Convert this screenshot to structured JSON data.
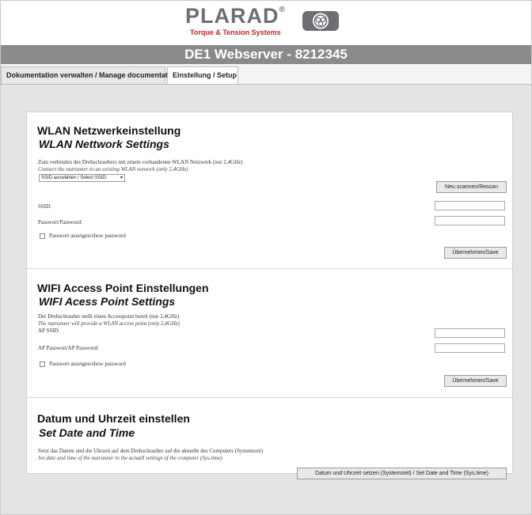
{
  "brand": {
    "name": "PLARAD",
    "reg": "®",
    "tagline": "Torque & Tension Systems",
    "color_red": "#c1272d",
    "color_gray": "#6d6f72"
  },
  "title": "DE1 Webserver - 8212345",
  "tabs": [
    {
      "label": "Dokumentation verwalten / Manage documentation",
      "active": false
    },
    {
      "label": "Einstellung / Setup",
      "active": true
    }
  ],
  "wlan": {
    "title_de": "WLAN Netzwerkeinstellung",
    "title_en": "WLAN Nettwork Settings",
    "desc_de": "Zum verbinden des Drehschraubers mit einem vorhandenen WLAN Netzwerk (nur 2,4GHz)",
    "desc_en": "Connect the nutrunner to an existing WLAN network (only 2,4GHz)",
    "ssid_select": "SSID auswählen / Select SSID:",
    "rescan_button": "Neu scannen/Rescan",
    "ssid_label": "SSID:",
    "ssid_value": "",
    "password_label": "Passwort/Password:",
    "password_value": "",
    "show_password_label": "Passwort anzeigen/show password",
    "save_button": "Übernehmen/Save"
  },
  "ap": {
    "title_de": "WIFI Access Point Einstellungen",
    "title_en": "WIFI Acess Point Settings",
    "desc_de": "Der Drehschrauber stellt einen Accesspoint bereit (nur 2,4GHz)",
    "desc_en": "The nutrunner will provide a WLAN access point (only 2,4GHz)",
    "ssid_label": "AP SSID:",
    "ssid_value": "",
    "password_label": "AP Passwort/AP Password:",
    "password_value": "",
    "show_password_label": "Passwort anzeigen/show password",
    "save_button": "Übernehmen/Save"
  },
  "datetime": {
    "title_de": "Datum und Uhrzeit einstellen",
    "title_en": "Set Date and Time",
    "desc_de": "Setzt das Datum und die Uhrzeit auf dem Drehschrauber auf die aktuelle des Computers (Systemzeit)",
    "desc_en": "Set date and time of the nutrunner to the actuall settings of the computer (Sys.time)",
    "set_button": "Datum und Uhrzeit setzen (Systemzeit) / Set Date and Time (Sys.time)"
  }
}
